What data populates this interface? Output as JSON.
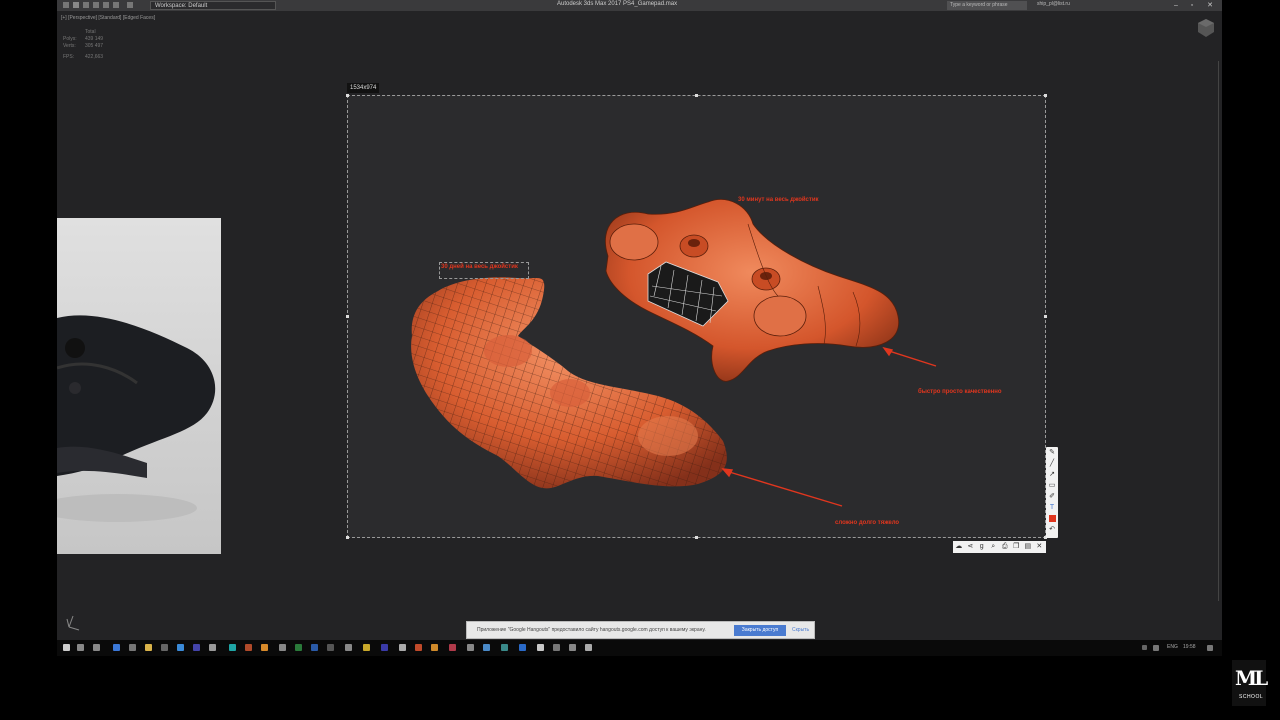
{
  "titlebar": {
    "workspace": "Workspace: Default",
    "title": "Autodesk 3ds Max 2017     PS4_Gamepad.max",
    "search_placeholder": "Type a keyword or phrase",
    "account": "ship_pl@list.ru"
  },
  "viewport": {
    "label": "[+] [Perspective] [Standard] [Edged Faces]",
    "stats": {
      "total": "Total",
      "polys_label": "Polys:",
      "polys_value": "439 149",
      "verts_label": "Verts:",
      "verts_value": "305 497",
      "fps_label": "FPS:",
      "fps_value": "422,663"
    }
  },
  "capture": {
    "dimensions": "1534x974",
    "annotations": [
      "30 минут на весь джойстик",
      "30 дней на весь джойстик",
      "быстро просто качественно",
      "сложно долго тяжело"
    ]
  },
  "hangouts": {
    "message": "Приложение \"Google Hangouts\" предоставило сайту hangouts.google.com доступ к вашему экрану.",
    "share_button": "Закрыть доступ",
    "hide_button": "Скрыть"
  },
  "taskbar": {
    "lang": "ENG",
    "time": "19:58"
  },
  "logo": {
    "main": "ML",
    "sub": "SCHOOL"
  },
  "colors": {
    "model": "#d4562c",
    "annotation": "#e0361e",
    "accent": "#4a7bd0"
  }
}
